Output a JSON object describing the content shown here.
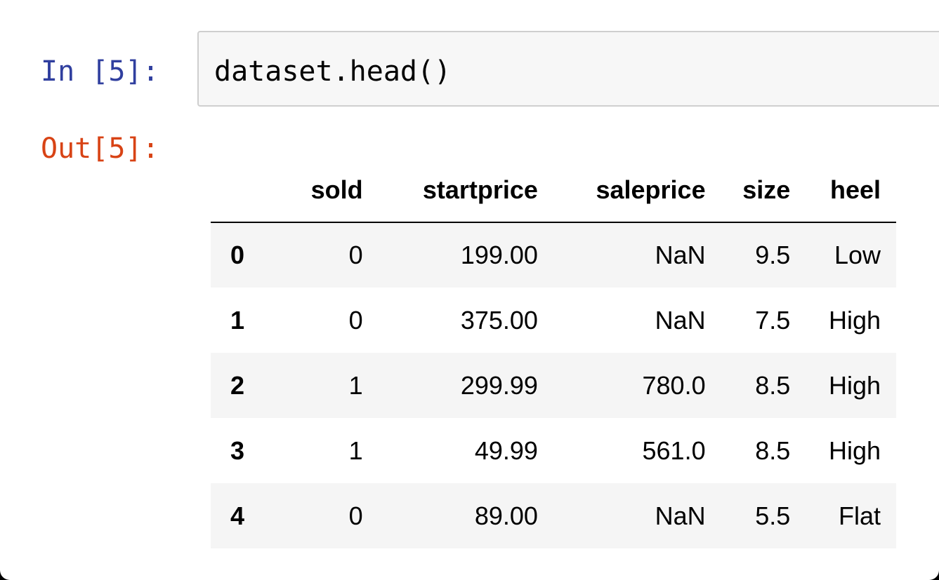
{
  "cell": {
    "input_prompt": "In [5]:",
    "output_prompt": "Out[5]:",
    "code": "dataset.head()"
  },
  "dataframe": {
    "columns": [
      "sold",
      "startprice",
      "saleprice",
      "size",
      "heel"
    ],
    "rows": [
      {
        "index": "0",
        "values": [
          "0",
          "199.00",
          "NaN",
          "9.5",
          "Low"
        ]
      },
      {
        "index": "1",
        "values": [
          "0",
          "375.00",
          "NaN",
          "7.5",
          "High"
        ]
      },
      {
        "index": "2",
        "values": [
          "1",
          "299.99",
          "780.0",
          "8.5",
          "High"
        ]
      },
      {
        "index": "3",
        "values": [
          "1",
          "49.99",
          "561.0",
          "8.5",
          "High"
        ]
      },
      {
        "index": "4",
        "values": [
          "0",
          "89.00",
          "NaN",
          "5.5",
          "Flat"
        ]
      }
    ]
  },
  "colors": {
    "input_prompt": "#303f9f",
    "output_prompt": "#d84315",
    "input_background": "#f7f7f7",
    "row_stripe": "#f5f5f5"
  }
}
